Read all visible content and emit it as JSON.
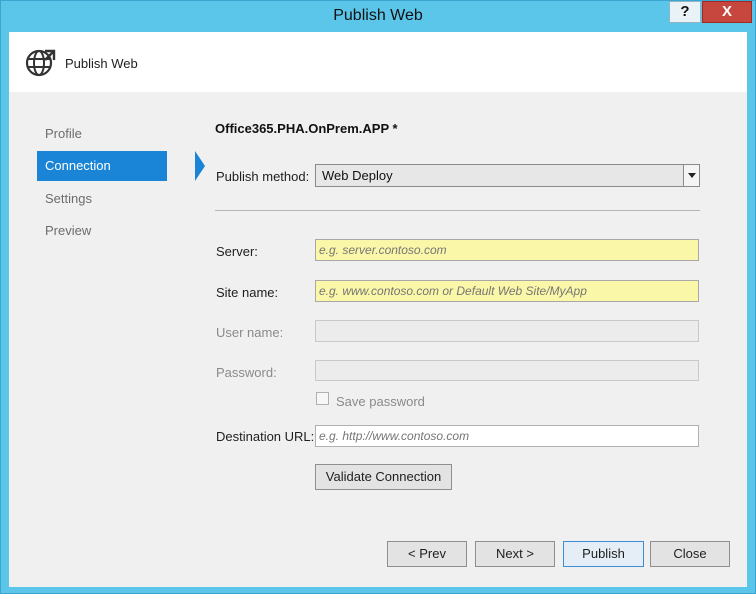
{
  "window": {
    "title": "Publish Web",
    "help": "?",
    "close": "X"
  },
  "header": {
    "title": "Publish Web",
    "icon": "globe-publish-icon"
  },
  "nav": {
    "items": [
      {
        "label": "Profile"
      },
      {
        "label": "Connection",
        "active": true
      },
      {
        "label": "Settings"
      },
      {
        "label": "Preview"
      }
    ]
  },
  "profile": {
    "name": "Office365.PHA.OnPrem.APP *"
  },
  "form": {
    "publish_method": {
      "label": "Publish method:",
      "value": "Web Deploy"
    },
    "server": {
      "label": "Server:",
      "placeholder": "e.g. server.contoso.com"
    },
    "site_name": {
      "label": "Site name:",
      "placeholder": "e.g. www.contoso.com or Default Web Site/MyApp"
    },
    "user_name": {
      "label": "User name:",
      "value": ""
    },
    "password": {
      "label": "Password:",
      "value": ""
    },
    "save_password": {
      "label": "Save password"
    },
    "destination_url": {
      "label": "Destination URL:",
      "placeholder": "e.g. http://www.contoso.com"
    },
    "validate": {
      "label": "Validate Connection"
    }
  },
  "footer": {
    "prev": "< Prev",
    "next": "Next >",
    "publish": "Publish",
    "close": "Close"
  },
  "colors": {
    "title_bar": "#5cc5ea",
    "accent": "#1a85d6",
    "required_field": "#fbf7a8",
    "close_button": "#c7463d"
  }
}
